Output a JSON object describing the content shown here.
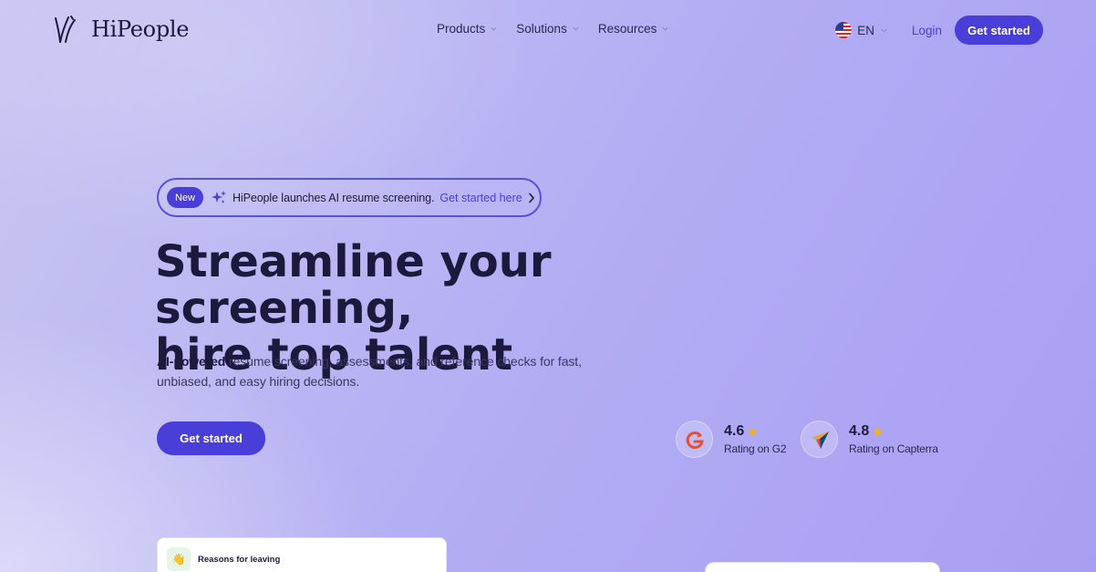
{
  "brand": {
    "name": "HiPeople"
  },
  "nav": {
    "items": [
      {
        "label": "Products"
      },
      {
        "label": "Solutions"
      },
      {
        "label": "Resources"
      }
    ],
    "language": "EN",
    "login": "Login",
    "cta": "Get started"
  },
  "announcement": {
    "badge": "New",
    "text": "HiPeople launches AI resume screening.",
    "link": "Get started here"
  },
  "hero": {
    "title_line1": "Streamline your screening,",
    "title_line2": "hire top talent",
    "subtitle_bold": "AI-powered",
    "subtitle_rest": " resume screening, assessments, and reference checks for fast, unbiased, and easy hiring decisions.",
    "cta": "Get started"
  },
  "ratings": [
    {
      "score": "4.6",
      "label": "Rating on G2",
      "icon": "g2-logo-icon"
    },
    {
      "score": "4.8",
      "label": "Rating on Capterra",
      "icon": "capterra-logo-icon"
    }
  ],
  "preview_card": {
    "title": "Reasons for leaving"
  },
  "colors": {
    "accent": "#4a3ed9",
    "star": "#f5b400",
    "text": "#1b1a3d"
  }
}
